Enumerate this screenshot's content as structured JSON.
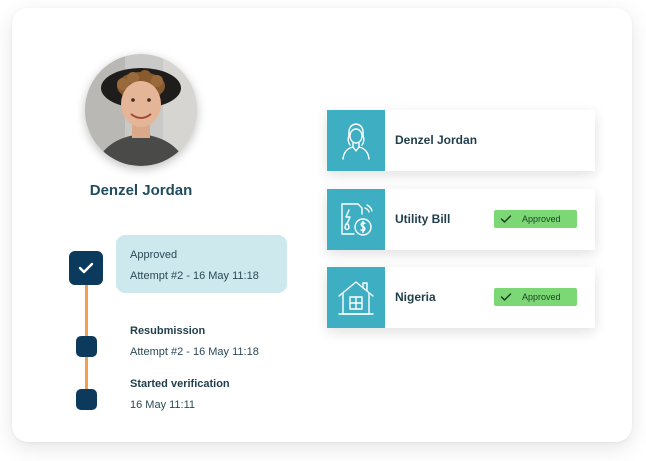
{
  "profile": {
    "name": "Denzel Jordan",
    "avatar_icon": "user-photo-icon"
  },
  "timeline": {
    "current": {
      "title": "Approved",
      "subtitle": "Attempt #2 - 16 May 11:18",
      "icon": "checkmark-icon"
    },
    "steps": [
      {
        "title": "Resubmission",
        "subtitle": "Attempt #2 - 16 May 11:18"
      },
      {
        "title": "Started verification",
        "subtitle": "16 May 11:11"
      }
    ]
  },
  "checks": [
    {
      "label": "Denzel Jordan",
      "icon": "person-icon",
      "status": ""
    },
    {
      "label": "Utility Bill",
      "icon": "bill-icon",
      "status": "Approved"
    },
    {
      "label": "Nigeria",
      "icon": "house-icon",
      "status": "Approved"
    }
  ],
  "colors": {
    "accent": "#3eaec3",
    "navy": "#0b3a5c",
    "timeline_line": "#f0a04b",
    "status_box": "#cde9ee",
    "badge": "#7cd875",
    "name_text": "#1f4d5e"
  }
}
